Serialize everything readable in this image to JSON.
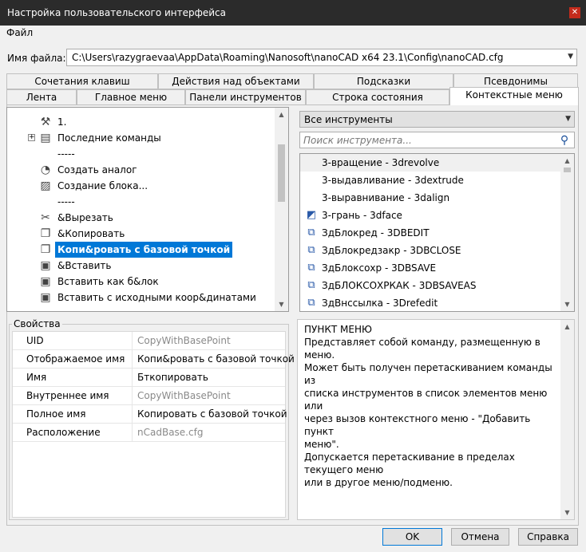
{
  "window": {
    "title": "Настройка пользовательского интерфейса",
    "close_glyph": "✕"
  },
  "menu": {
    "file": "Файл"
  },
  "file": {
    "label": "Имя файла:",
    "value": "C:\\Users\\razygraevaa\\AppData\\Roaming\\Nanosoft\\nanoCAD x64 23.1\\Config\\nanoCAD.cfg"
  },
  "tabs_row1": [
    {
      "label": "Сочетания клавиш"
    },
    {
      "label": "Действия над объектами"
    },
    {
      "label": "Подсказки"
    },
    {
      "label": "Псевдонимы"
    }
  ],
  "tabs_row2": [
    {
      "label": "Лента"
    },
    {
      "label": "Главное меню"
    },
    {
      "label": "Панели инструментов"
    },
    {
      "label": "Строка состояния"
    },
    {
      "label": "Контекстные меню"
    }
  ],
  "tree": {
    "items": [
      {
        "label": "1.",
        "icon": "hammer-icon",
        "glyph": "⚒"
      },
      {
        "label": "Последние команды",
        "icon": "commands-icon",
        "glyph": "▤",
        "expander": "+"
      },
      {
        "label": "-----"
      },
      {
        "label": "Создать аналог",
        "icon": "clone-icon",
        "glyph": "◔"
      },
      {
        "label": "Создание блока...",
        "icon": "block-icon",
        "glyph": "▨"
      },
      {
        "label": "-----"
      },
      {
        "label": "&Вырезать",
        "icon": "cut-icon",
        "glyph": "✂"
      },
      {
        "label": "&Копировать",
        "icon": "copy-icon",
        "glyph": "❐"
      },
      {
        "label": "Копи&ровать с базовой точкой",
        "icon": "copy-base-icon",
        "glyph": "❐",
        "selected": true
      },
      {
        "label": "&Вставить",
        "icon": "paste-icon",
        "glyph": "▣"
      },
      {
        "label": "Вставить как б&лок",
        "icon": "paste-block-icon",
        "glyph": "▣"
      },
      {
        "label": "Вставить с исходными коор&динатами",
        "icon": "paste-coords-icon",
        "glyph": "▣"
      }
    ]
  },
  "tools": {
    "filter": "Все инструменты",
    "search_placeholder": "Поиск инструмента...",
    "items": [
      {
        "label": "3-вращение - 3drevolve",
        "icon": ""
      },
      {
        "label": "3-выдавливание - 3dextrude",
        "icon": ""
      },
      {
        "label": "3-выравнивание - 3dalign",
        "icon": ""
      },
      {
        "label": "3-грань - 3dface",
        "icon": "face-icon",
        "glyph": "◩"
      },
      {
        "label": "ЗдБлокред - 3DBEDIT",
        "icon": "block-edit-icon",
        "glyph": "⧉"
      },
      {
        "label": "ЗдБлокредзакр - 3DBCLOSE",
        "icon": "block-close-icon",
        "glyph": "⧉"
      },
      {
        "label": "ЗдБлоксохр - 3DBSAVE",
        "icon": "block-save-icon",
        "glyph": "⧉"
      },
      {
        "label": "ЗдБЛОКСОХРКАК - 3DBSAVEAS",
        "icon": "block-saveas-icon",
        "glyph": "⧉"
      },
      {
        "label": "ЗдВнссылка - 3Drefedit",
        "icon": "refedit-icon",
        "glyph": "⧉"
      }
    ]
  },
  "properties": {
    "title": "Свойства",
    "rows": [
      {
        "key": "UID",
        "value": "CopyWithBasePoint",
        "gray": true
      },
      {
        "key": "Отображаемое имя",
        "value": "Копи&ровать с базовой точкой",
        "gray": false
      },
      {
        "key": "Имя",
        "value": "Бткопировать",
        "gray": false
      },
      {
        "key": "Внутреннее имя",
        "value": "CopyWithBasePoint",
        "gray": true
      },
      {
        "key": "Полное имя",
        "value": "Копировать с базовой точкой",
        "gray": false
      },
      {
        "key": "Расположение",
        "value": "nCadBase.cfg",
        "gray": true
      }
    ]
  },
  "description": {
    "lines": [
      "ПУНКТ МЕНЮ",
      "Представляет собой команду, размещенную в меню.",
      "Может быть получен перетаскиванием команды из",
      "списка инструментов в список элементов меню или",
      "через вызов контекстного меню - \"Добавить пункт",
      "меню\".",
      "Допускается перетаскивание в пределах текущего меню",
      "или в другое меню/подменю."
    ]
  },
  "buttons": {
    "ok": "OK",
    "cancel": "Отмена",
    "help": "Справка"
  }
}
